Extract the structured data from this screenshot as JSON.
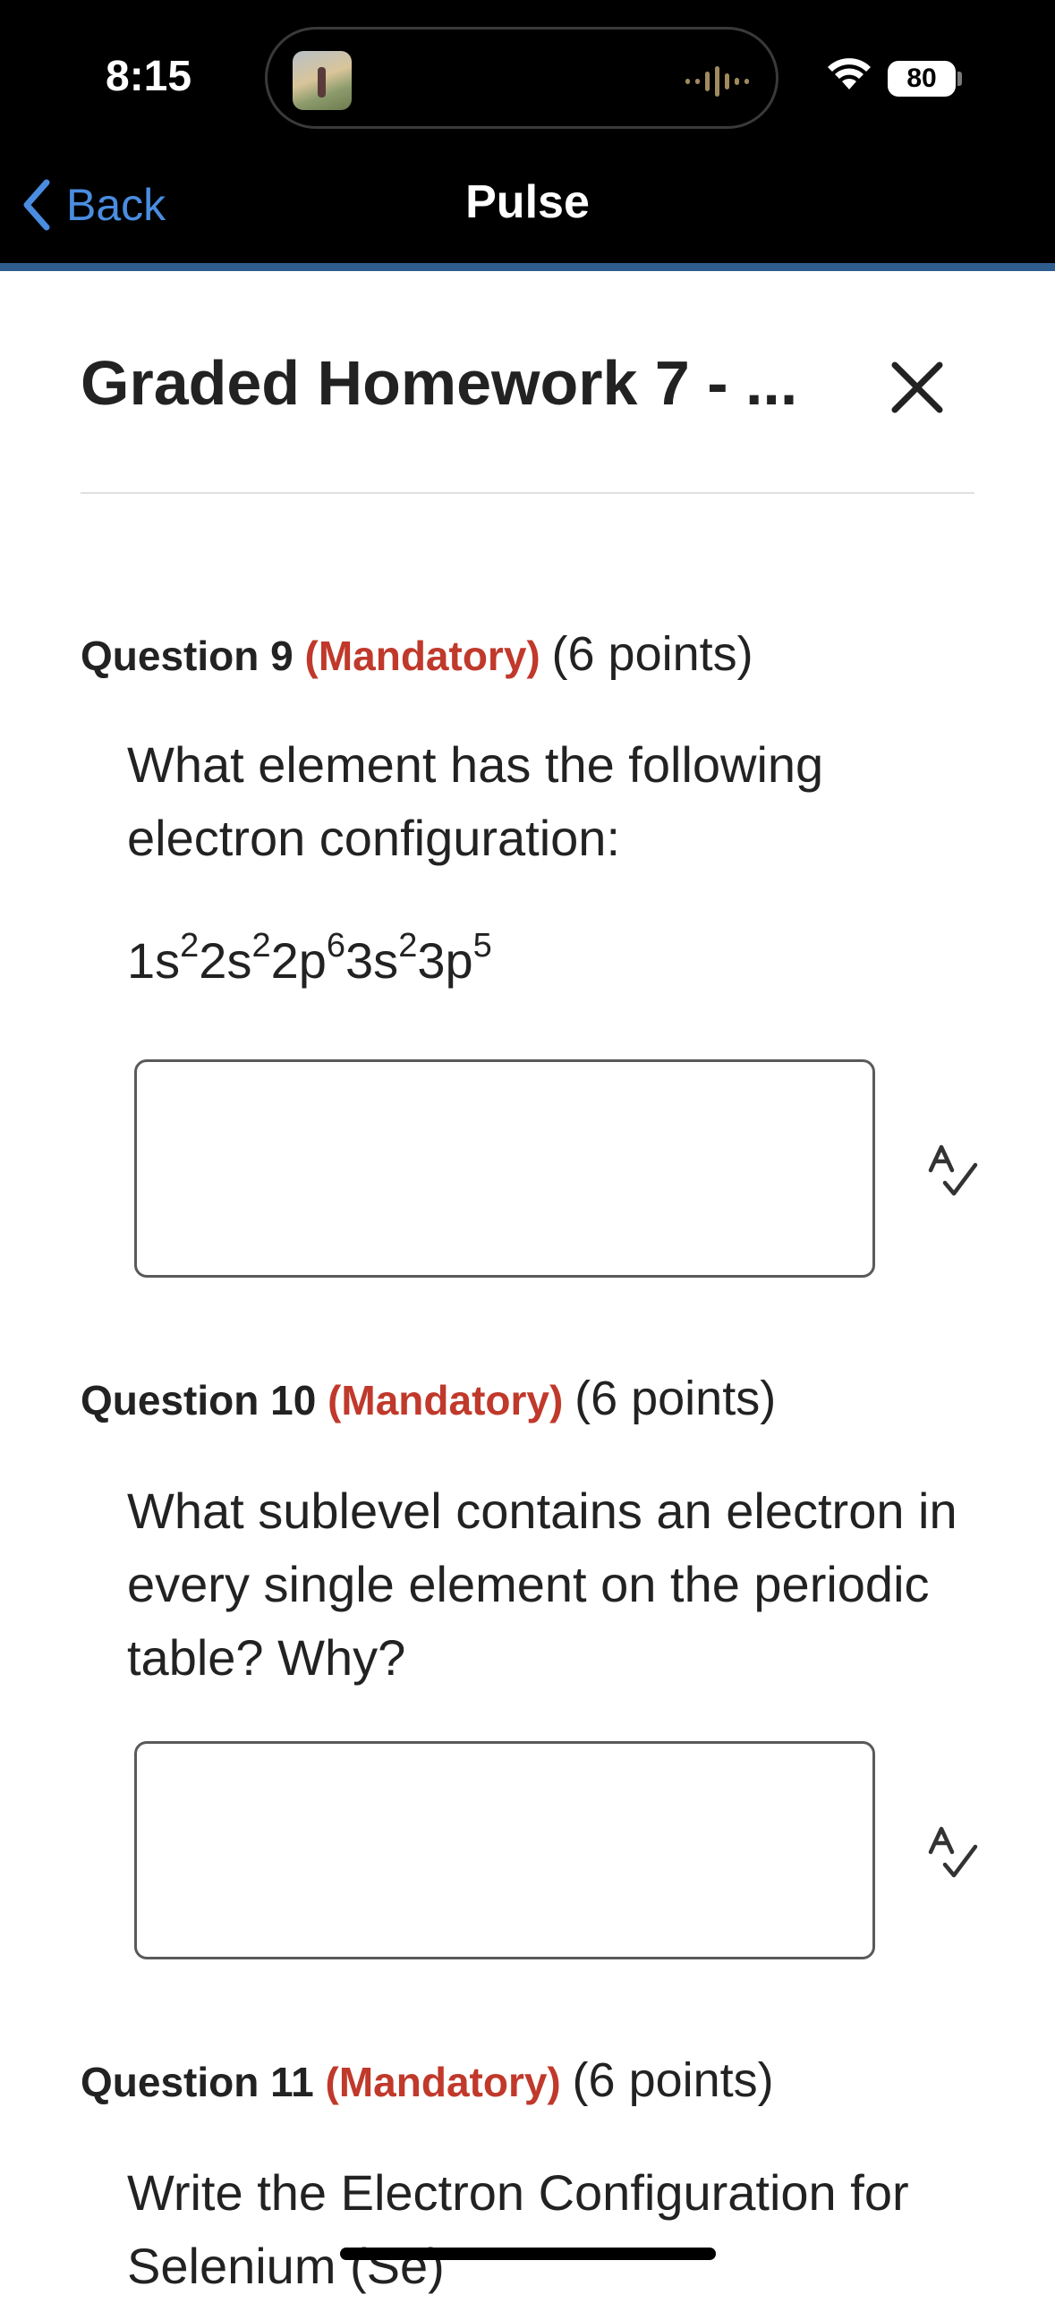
{
  "status": {
    "time": "8:15",
    "battery": "80"
  },
  "nav": {
    "back_label": "Back",
    "title": "Pulse"
  },
  "header": {
    "title": "Graded Homework 7 - ..."
  },
  "questions": [
    {
      "number": "Question 9",
      "mandatory": "(Mandatory)",
      "points": "(6 points)",
      "text": "What element has the following electron configuration:",
      "formula": [
        {
          "base": "1s",
          "sup": "2"
        },
        {
          "base": "2s",
          "sup": "2"
        },
        {
          "base": "2p",
          "sup": "6"
        },
        {
          "base": "3s",
          "sup": "2"
        },
        {
          "base": "3p",
          "sup": "5"
        }
      ]
    },
    {
      "number": "Question 10",
      "mandatory": "(Mandatory)",
      "points": "(6 points)",
      "text": "What sublevel contains an electron in every single element on the periodic table? Why?"
    },
    {
      "number": "Question 11",
      "mandatory": "(Mandatory)",
      "points": "(6 points)",
      "text": "Write the Electron Configuration for Selenium (Se)"
    }
  ],
  "colors": {
    "accent": "#4a8de0",
    "mandatory": "#c0392b",
    "nav_border": "#2e5d8d"
  },
  "icons": [
    "back-chevron-icon",
    "wifi-icon",
    "close-icon",
    "spellcheck-icon"
  ]
}
